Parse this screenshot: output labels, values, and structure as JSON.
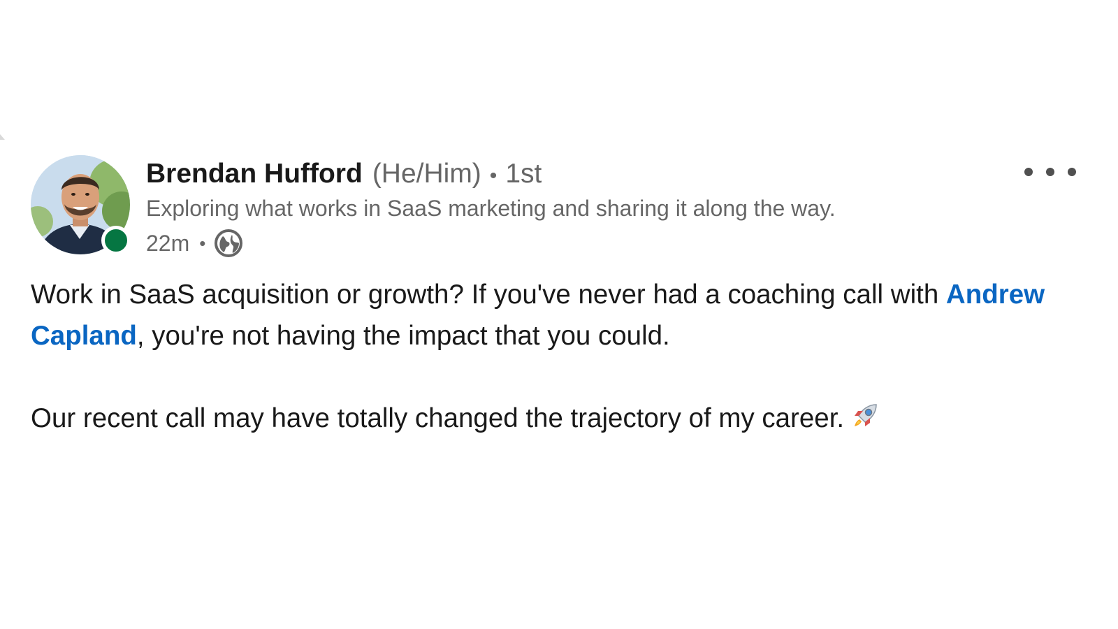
{
  "post": {
    "author": {
      "name": "Brendan Hufford",
      "pronouns": "(He/Him)",
      "separator": "•",
      "degree": "1st",
      "headline": "Exploring what works in SaaS marketing and sharing it along the way.",
      "online_status_color": "#057642"
    },
    "meta": {
      "time": "22m",
      "separator": "•",
      "visibility_icon": "globe-icon"
    },
    "menu_icon": "more-horizontal-icon",
    "body": {
      "line1_before_mention": "Work in SaaS acquisition or growth? If you've never had a coaching call with ",
      "mention": "Andrew Capland",
      "line1_after_mention": ", you're not having the impact that you could.",
      "paragraph2": "Our recent call may have totally changed the trajectory of my career.",
      "paragraph2_emoji_icon": "rocket-icon"
    },
    "colors": {
      "mention": "#0a66c2",
      "secondary_text": "#666666",
      "primary_text": "#191919"
    }
  }
}
